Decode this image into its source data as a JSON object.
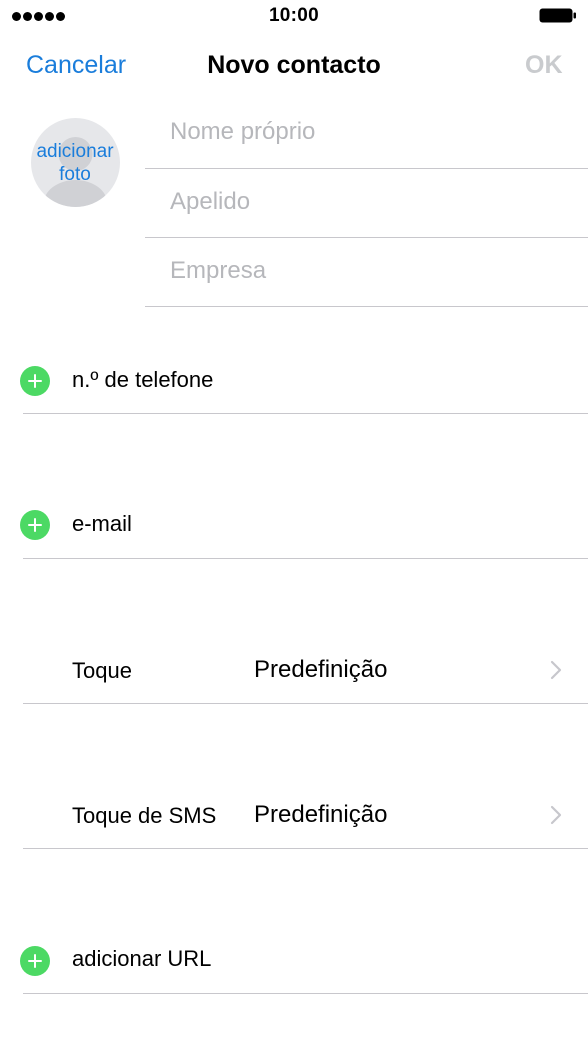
{
  "status_bar": {
    "signal_dots": 5,
    "time": "10:00",
    "battery_level": 1.0
  },
  "nav": {
    "cancel_label": "Cancelar",
    "title": "Novo contacto",
    "ok_label": "OK"
  },
  "photo": {
    "label_line1": "adicionar",
    "label_line2": "foto"
  },
  "name_fields": [
    {
      "placeholder": "Nome próprio"
    },
    {
      "placeholder": "Apelido"
    },
    {
      "placeholder": "Empresa"
    }
  ],
  "rows": {
    "phone": "n.º de telefone",
    "email": "e-mail",
    "ringtone": {
      "label": "Toque",
      "value": "Predefinição"
    },
    "text_tone": {
      "label": "Toque de SMS",
      "value": "Predefinição"
    },
    "url": "adicionar URL"
  },
  "colors": {
    "accent": "#1a7ddb",
    "add_green": "#4cd964",
    "disabled": "#c9cbce",
    "placeholder": "#b6b7bb",
    "separator": "#c8c7cc"
  }
}
